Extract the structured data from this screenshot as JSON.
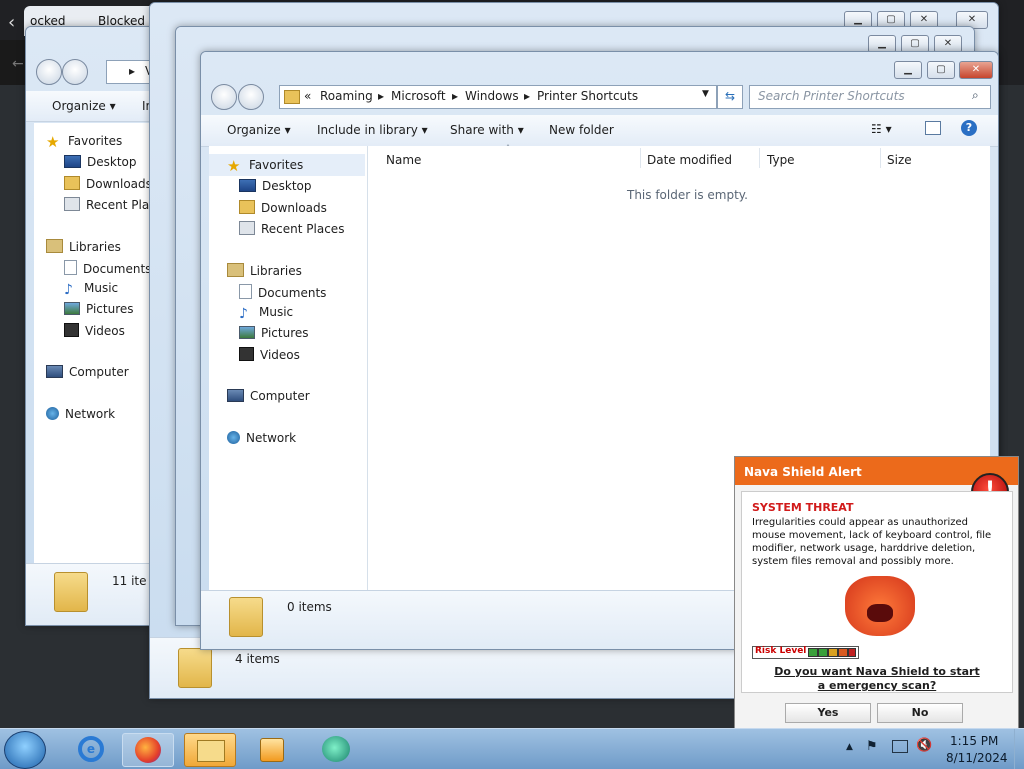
{
  "browser": {
    "tab1": "ocked",
    "tab2": "Blocked"
  },
  "win_back": {
    "address_first": "V",
    "toolbar": {
      "organize": "Organize",
      "include_cut": "Ir"
    },
    "nav": {
      "favorites": "Favorites",
      "desktop": "Desktop",
      "downloads": "Downloads",
      "recent": "Recent Place",
      "libraries": "Libraries",
      "documents": "Documents",
      "music": "Music",
      "pictures": "Pictures",
      "videos": "Videos",
      "computer": "Computer",
      "network": "Network"
    },
    "status_count": "11 ite"
  },
  "win_mid": {
    "status_count": "4 items"
  },
  "win_front": {
    "breadcrumb": [
      "«",
      "Roaming",
      "Microsoft",
      "Windows",
      "Printer Shortcuts"
    ],
    "search_placeholder": "Search Printer Shortcuts",
    "toolbar": {
      "organize": "Organize",
      "include": "Include in library",
      "share": "Share with",
      "new_folder": "New folder"
    },
    "nav": {
      "favorites": "Favorites",
      "desktop": "Desktop",
      "downloads": "Downloads",
      "recent": "Recent Places",
      "libraries": "Libraries",
      "documents": "Documents",
      "music": "Music",
      "pictures": "Pictures",
      "videos": "Videos",
      "computer": "Computer",
      "network": "Network"
    },
    "columns": {
      "name": "Name",
      "date": "Date modified",
      "type": "Type",
      "size": "Size"
    },
    "empty_text": "This folder is empty.",
    "status_count": "0 items"
  },
  "alert": {
    "title": "Nava Shield Alert",
    "threat_title": "SYSTEM THREAT",
    "threat_text": "Irregularities could appear as unauthorized mouse movement, lack of keyboard control, file modifier, network usage, harddrive deletion, system files removal and possibly more.",
    "risk_label": "Risk Level",
    "question": "Do you want Nava Shield to start a emergency scan?",
    "yes": "Yes",
    "no": "No",
    "accent": "#ec6a1b"
  },
  "taskbar": {
    "time": "1:15 PM",
    "date": "8/11/2024"
  }
}
